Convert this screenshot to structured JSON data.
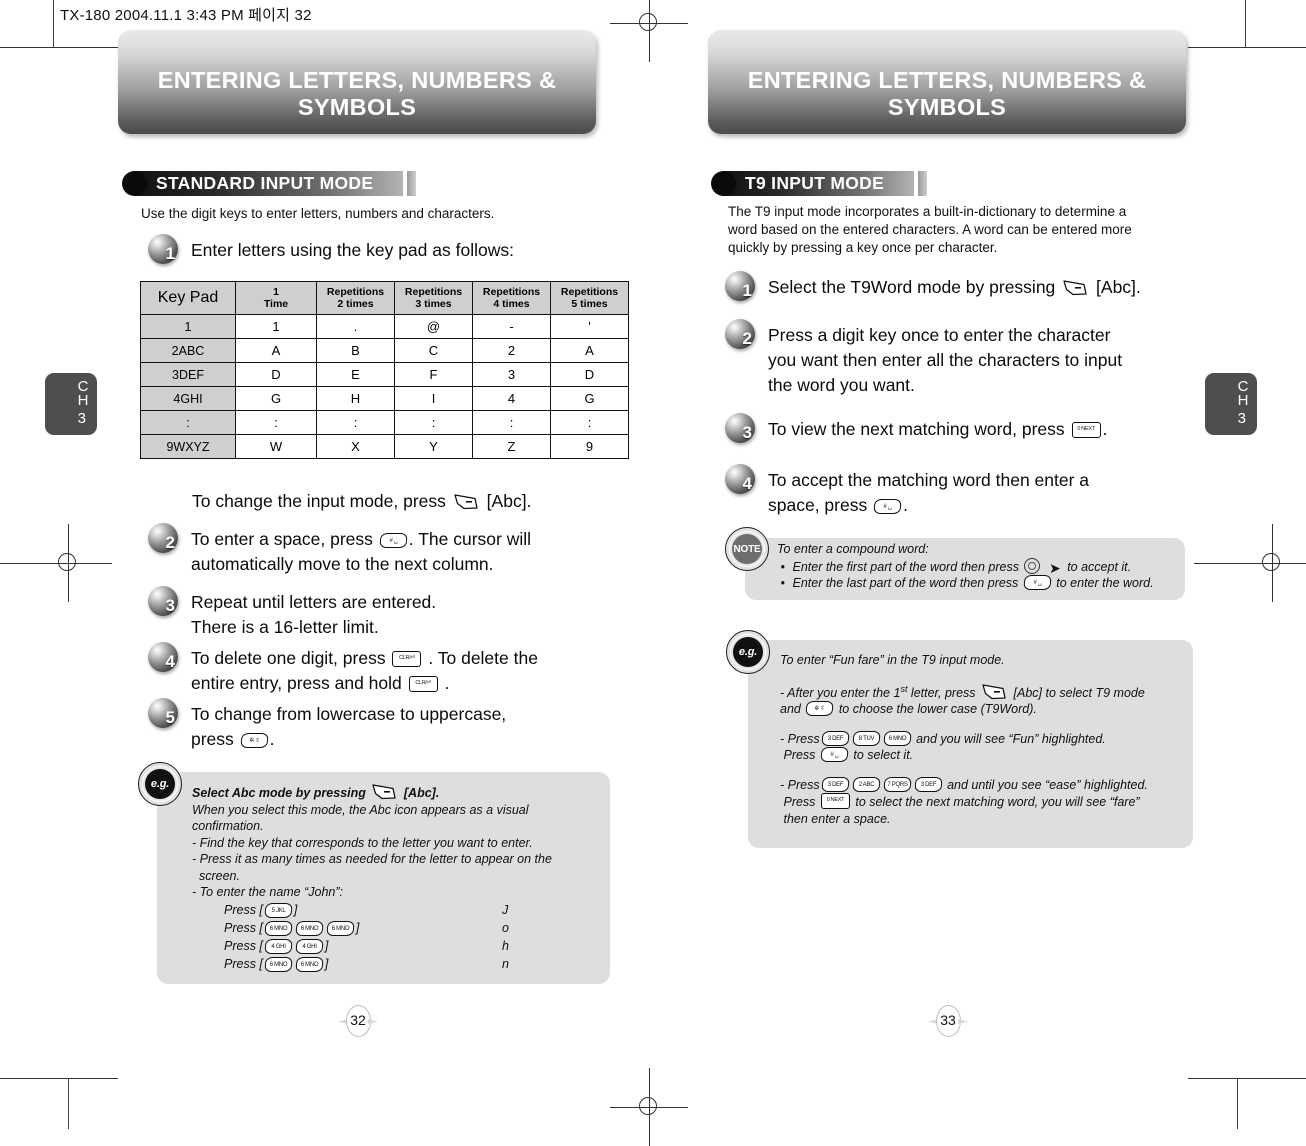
{
  "print": {
    "filestamp": "TX-180  2004.11.1 3:43 PM  페이지 32"
  },
  "left_page": {
    "banner_title": "ENTERING LETTERS, NUMBERS & SYMBOLS",
    "section_title": "STANDARD INPUT MODE",
    "intro": "Use the digit keys to enter letters, numbers and characters.",
    "chapter_tab": {
      "ch": "C\nH",
      "number": "3"
    },
    "page_number": "32",
    "step1": "Enter letters using the key pad as follows:",
    "keypad_table": {
      "headers": [
        "Key Pad",
        "1\nTime",
        "Repetitions\n2 times",
        "Repetitions\n3 times",
        "Repetitions\n4 times",
        "Repetitions\n5 times"
      ],
      "header_keypad": "Key Pad",
      "header_1time_top": "1",
      "header_1time_bottom": "Time",
      "header_rep_label": "Repetitions",
      "header_rep2": "2 times",
      "header_rep3": "3 times",
      "header_rep4": "4 times",
      "header_rep5": "5 times",
      "rows": [
        {
          "key": "1",
          "cells": [
            "1",
            ".",
            "@",
            "-",
            "'"
          ]
        },
        {
          "key": "2ABC",
          "cells": [
            "A",
            "B",
            "C",
            "2",
            "A"
          ]
        },
        {
          "key": "3DEF",
          "cells": [
            "D",
            "E",
            "F",
            "3",
            "D"
          ]
        },
        {
          "key": "4GHI",
          "cells": [
            "G",
            "H",
            "I",
            "4",
            "G"
          ]
        },
        {
          "key": ":",
          "cells": [
            ":",
            ":",
            ":",
            ":",
            ":"
          ]
        },
        {
          "key": "9WXYZ",
          "cells": [
            "W",
            "X",
            "Y",
            "Z",
            "9"
          ]
        }
      ]
    },
    "change_mode_pre": "To change the input mode, press",
    "change_mode_post": "[Abc].",
    "step2_a": "To enter a space, press",
    "step2_b": ". The cursor will",
    "step2_c": "automatically move to the next column.",
    "step3_a": "Repeat until letters are entered.",
    "step3_b": "There is a 16-letter limit.",
    "step4_a": "To delete one digit, press",
    "step4_b": ". To delete the",
    "step4_c": "entire entry, press and hold",
    "step4_d": ".",
    "step5_a": "To change from lowercase to uppercase,",
    "step5_b": "press",
    "step5_c": ".",
    "eg_box": {
      "badge": "e.g.",
      "title_pre": "Select Abc mode by pressing",
      "title_post": "[Abc].",
      "line1": "When you select this mode, the Abc icon appears as a visual",
      "line2": "confirmation.",
      "line3": "- Find the key that corresponds to the letter you want to enter.",
      "line4": "- Press it as many times as needed for the letter to appear on the",
      "line5": "screen.",
      "line6": "- To enter the name “John”:",
      "press_label": "Press [",
      "close_label": "]",
      "rows": [
        {
          "keys": [
            "5 JKL"
          ],
          "result": "J"
        },
        {
          "keys": [
            "6 MNO",
            "6 MNO",
            "6 MNO"
          ],
          "result": "o"
        },
        {
          "keys": [
            "4 GHI",
            "4 GHI"
          ],
          "result": "h"
        },
        {
          "keys": [
            "6 MNO",
            "6 MNO"
          ],
          "result": "n"
        }
      ]
    }
  },
  "right_page": {
    "banner_title": "ENTERING LETTERS, NUMBERS & SYMBOLS",
    "section_title": "T9 INPUT MODE",
    "chapter_tab": {
      "ch": "C\nH",
      "number": "3"
    },
    "page_number": "33",
    "intro_l1": "The T9 input mode incorporates a built-in-dictionary to determine a",
    "intro_l2": "word based on the entered characters. A word can be entered more",
    "intro_l3": "quickly by pressing a key once per character.",
    "step1_a": "Select the T9Word mode by pressing",
    "step1_b": "[Abc].",
    "step2_a": "Press a digit key once to enter the character",
    "step2_b": "you want then enter all the characters to input",
    "step2_c": "the word you want.",
    "step3_a": "To view the next matching word, press",
    "step3_b": ".",
    "step4_a": "To accept the matching word then enter a",
    "step4_b": "space, press",
    "step4_c": ".",
    "note_box": {
      "badge": "NOTE",
      "title": "To enter a compound word:",
      "b1_a": "Enter the first part of the word then press",
      "b1_b": "to accept it.",
      "b2_a": "Enter the last part of the word then press",
      "b2_b": "to enter the word."
    },
    "eg_box": {
      "badge": "e.g.",
      "title": "To enter “Fun fare” in the T9 input mode.",
      "p1_a": "- After you enter the 1",
      "p1_sup": "st",
      "p1_b": " letter,  press",
      "p1_c": "[Abc] to select T9 mode",
      "p1_d": "and",
      "p1_e": "to choose the lower case (T9Word).",
      "p2_a": "- Press",
      "p2_keys": [
        "3 DEF",
        "8 TUV",
        "6 MNO"
      ],
      "p2_b": "and you will see “Fun” highlighted.",
      "p2_c": "Press",
      "p2_d": "to select it.",
      "p3_a": "- Press",
      "p3_keys": [
        "3 DEF",
        "2 ABC",
        "7 PQRS",
        "3 DEF"
      ],
      "p3_b": "and until you see “ease” highlighted.",
      "p3_c": "Press",
      "p3_d": "to select the next matching word, you will see “fare”",
      "p3_e": "then enter a space."
    }
  },
  "key_glyphs": {
    "softkey_abc": "softkey-abc-icon",
    "pound_space": "#  ␣",
    "star_shift": "✲ ⇧",
    "zero_next": "0 NEXT",
    "clr": "CLR/⏎"
  }
}
